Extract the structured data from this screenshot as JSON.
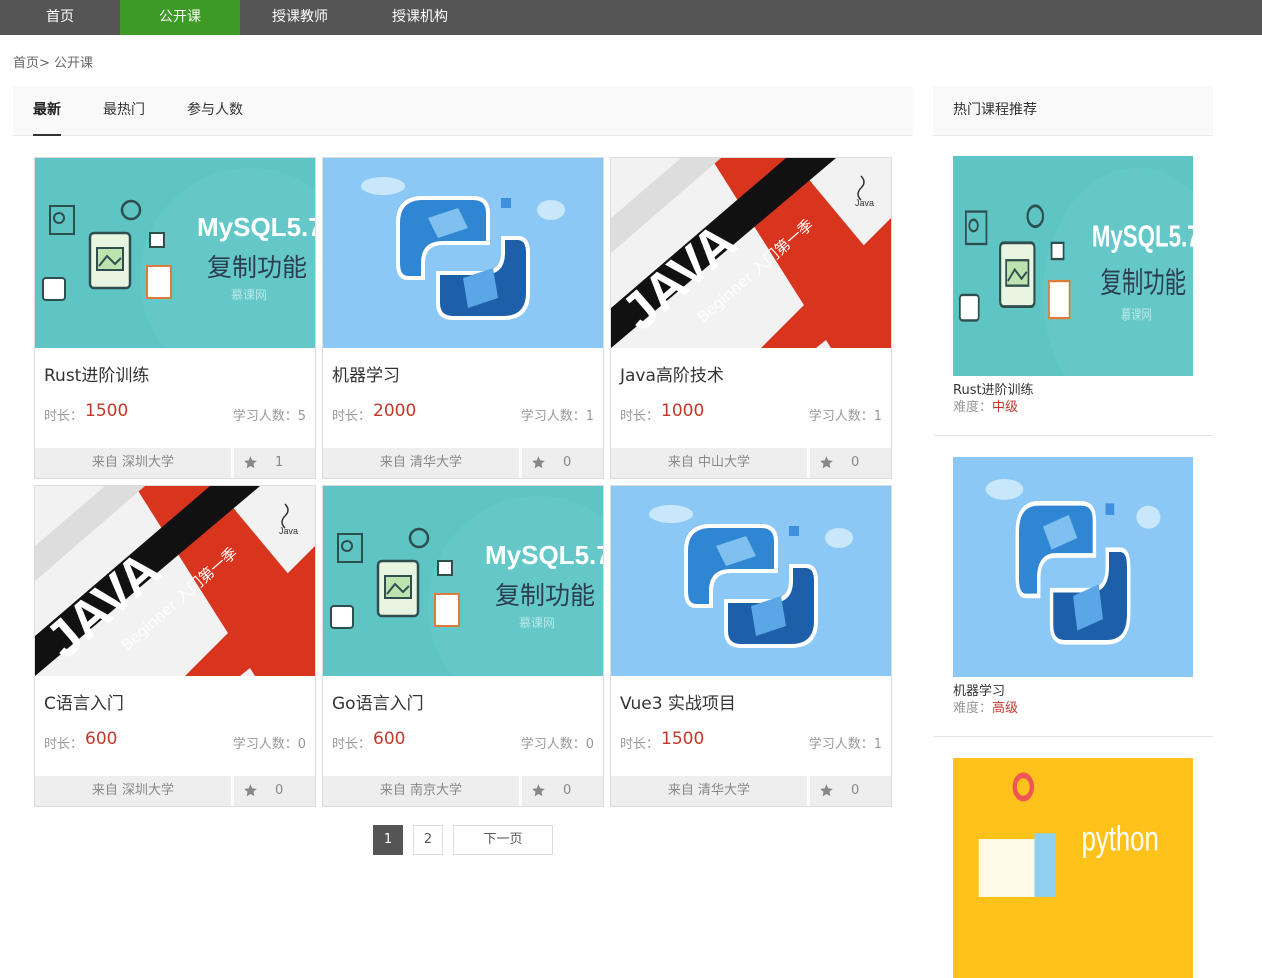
{
  "nav": {
    "items": [
      "首页",
      "公开课",
      "授课教师",
      "授课机构"
    ],
    "active_index": 1,
    "active_color": "#3d9a25",
    "background": "#555555"
  },
  "breadcrumb": "首页> 公开课",
  "tabs": {
    "items": [
      "最新",
      "最热门",
      "参与人数"
    ],
    "active_index": 0
  },
  "courses": [
    {
      "title": "Rust进阶训练",
      "duration_label": "时长：",
      "duration": "1500",
      "students": "学习人数：5",
      "from": "来自 深圳大学",
      "favorites": "1",
      "thumb": "mysql",
      "thumb_text": "MySQL5.7",
      "thumb_sub": "复制功能",
      "thumb_brand": "慕课网"
    },
    {
      "title": "机器学习",
      "duration_label": "时长：",
      "duration": "2000",
      "students": "学习人数：1",
      "from": "来自 清华大学",
      "favorites": "0",
      "thumb": "python-blue"
    },
    {
      "title": "Java高阶技术",
      "duration_label": "时长：",
      "duration": "1000",
      "students": "学习人数：1",
      "from": "来自 中山大学",
      "favorites": "0",
      "thumb": "java",
      "thumb_text": "JAVA",
      "thumb_sub": "Beginner 入门第一季",
      "thumb_logo": "Java"
    },
    {
      "title": "C语言入门",
      "duration_label": "时长：",
      "duration": "600",
      "students": "学习人数：0",
      "from": "来自 深圳大学",
      "favorites": "0",
      "thumb": "java",
      "thumb_text": "JAVA",
      "thumb_sub": "Beginner 入门第一季",
      "thumb_logo": "Java"
    },
    {
      "title": "Go语言入门",
      "duration_label": "时长：",
      "duration": "600",
      "students": "学习人数：0",
      "from": "来自 南京大学",
      "favorites": "0",
      "thumb": "mysql",
      "thumb_text": "MySQL5.7",
      "thumb_sub": "复制功能",
      "thumb_brand": "慕课网"
    },
    {
      "title": "Vue3 实战项目",
      "duration_label": "时长：",
      "duration": "1500",
      "students": "学习人数：1",
      "from": "来自 清华大学",
      "favorites": "0",
      "thumb": "python-blue"
    }
  ],
  "pagination": {
    "pages": [
      "1",
      "2"
    ],
    "active": "1",
    "next_label": "下一页"
  },
  "sidebar": {
    "title": "热门课程推荐",
    "level_label": "难度：",
    "items": [
      {
        "name": "Rust进阶训练",
        "level": "中级",
        "thumb": "mysql",
        "thumb_text": "MySQL5.7",
        "thumb_sub": "复制功能",
        "thumb_brand": "慕课网"
      },
      {
        "name": "机器学习",
        "level": "高级",
        "thumb": "python-blue"
      },
      {
        "name": "",
        "level": "",
        "thumb": "python-yellow",
        "thumb_text": "python"
      }
    ]
  },
  "colors": {
    "price_red": "#c0392b",
    "mysql_bg": "#5ec4c4",
    "python_bg": "#8cc8f5",
    "python_yellow_bg": "#ffc21a"
  }
}
